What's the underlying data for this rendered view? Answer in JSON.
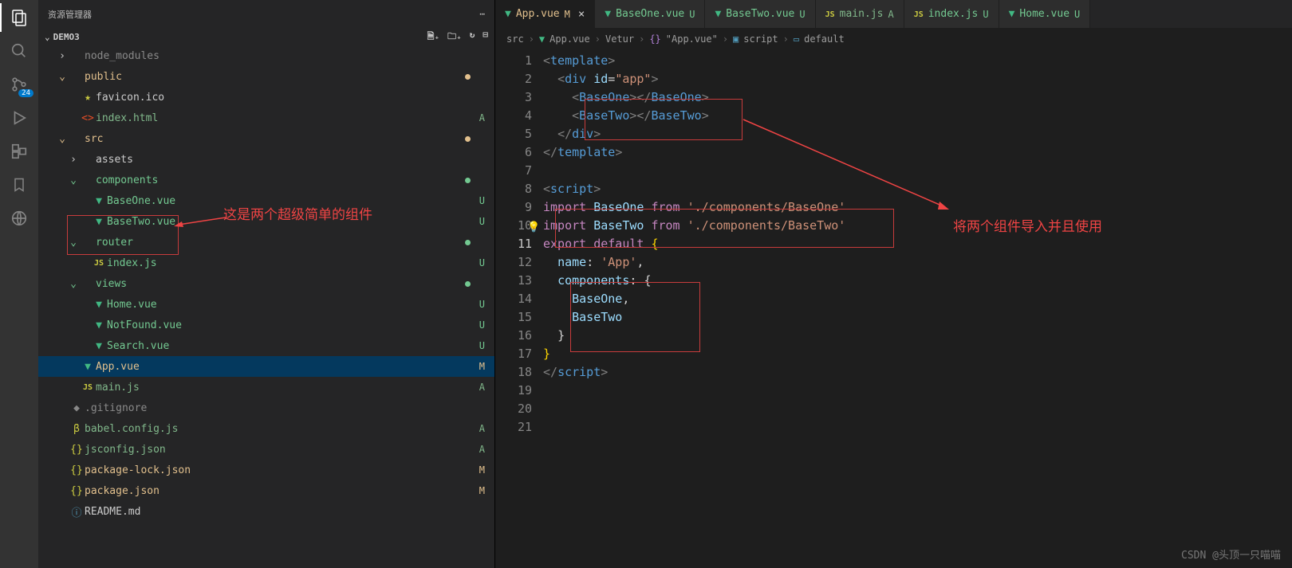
{
  "sidebar": {
    "title": "资源管理器",
    "project": "DEMO3",
    "scmBadge": "24"
  },
  "tree": [
    {
      "indent": 1,
      "chev": "›",
      "label": "node_modules",
      "dim": true
    },
    {
      "indent": 1,
      "chev": "⌄",
      "label": "public",
      "git": "M",
      "dot": true
    },
    {
      "indent": 2,
      "icon": "star",
      "label": "favicon.ico"
    },
    {
      "indent": 2,
      "icon": "html",
      "label": "index.html",
      "git": "A",
      "status": "A"
    },
    {
      "indent": 1,
      "chev": "⌄",
      "label": "src",
      "git": "M",
      "dot": true
    },
    {
      "indent": 2,
      "chev": "›",
      "label": "assets"
    },
    {
      "indent": 2,
      "chev": "⌄",
      "label": "components",
      "git": "U",
      "dot": true
    },
    {
      "indent": 3,
      "icon": "vue",
      "label": "BaseOne.vue",
      "git": "U",
      "status": "U"
    },
    {
      "indent": 3,
      "icon": "vue",
      "label": "BaseTwo.vue",
      "git": "U",
      "status": "U"
    },
    {
      "indent": 2,
      "chev": "⌄",
      "label": "router",
      "git": "U",
      "dot": true
    },
    {
      "indent": 3,
      "icon": "js",
      "label": "index.js",
      "git": "U",
      "status": "U"
    },
    {
      "indent": 2,
      "chev": "⌄",
      "label": "views",
      "git": "U",
      "dot": true
    },
    {
      "indent": 3,
      "icon": "vue",
      "label": "Home.vue",
      "git": "U",
      "status": "U"
    },
    {
      "indent": 3,
      "icon": "vue",
      "label": "NotFound.vue",
      "git": "U",
      "status": "U"
    },
    {
      "indent": 3,
      "icon": "vue",
      "label": "Search.vue",
      "git": "U",
      "status": "U"
    },
    {
      "indent": 2,
      "icon": "vue",
      "label": "App.vue",
      "git": "M",
      "status": "M",
      "active": true
    },
    {
      "indent": 2,
      "icon": "js",
      "label": "main.js",
      "git": "A",
      "status": "A"
    },
    {
      "indent": 1,
      "icon": "git",
      "label": ".gitignore",
      "dim": true
    },
    {
      "indent": 1,
      "icon": "babel",
      "label": "babel.config.js",
      "git": "A",
      "status": "A"
    },
    {
      "indent": 1,
      "icon": "json",
      "label": "jsconfig.json",
      "git": "A",
      "status": "A"
    },
    {
      "indent": 1,
      "icon": "json",
      "label": "package-lock.json",
      "git": "M",
      "status": "M"
    },
    {
      "indent": 1,
      "icon": "json",
      "label": "package.json",
      "git": "M",
      "status": "M"
    },
    {
      "indent": 1,
      "icon": "info",
      "label": "README.md"
    }
  ],
  "tabs": [
    {
      "icon": "vue",
      "name": "App.vue",
      "status": "M",
      "git": "M",
      "active": true,
      "close": true
    },
    {
      "icon": "vue",
      "name": "BaseOne.vue",
      "status": "U",
      "git": "U"
    },
    {
      "icon": "vue",
      "name": "BaseTwo.vue",
      "status": "U",
      "git": "U"
    },
    {
      "icon": "js",
      "name": "main.js",
      "status": "A",
      "git": "A"
    },
    {
      "icon": "js",
      "name": "index.js",
      "status": "U",
      "git": "U"
    },
    {
      "icon": "vue",
      "name": "Home.vue",
      "status": "U",
      "git": "U"
    }
  ],
  "breadcrumbs": {
    "p1": "src",
    "p2": "App.vue",
    "p3": "Vetur",
    "p4": "\"App.vue\"",
    "p5": "script",
    "p6": "default"
  },
  "code": {
    "count": 21,
    "currentLine": 11
  },
  "annotations": {
    "left": "这是两个超级简单的组件",
    "right": "将两个组件导入并且使用"
  },
  "watermark": "CSDN @头顶一只喵喵"
}
